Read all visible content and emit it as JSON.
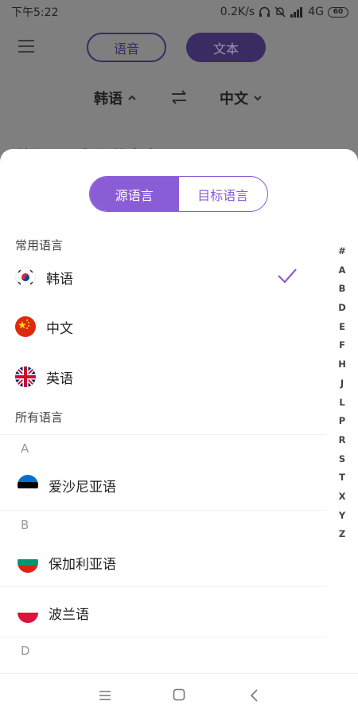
{
  "status": {
    "time": "下午5:22",
    "speed": "0.2K/s",
    "network": "4G",
    "battery": "60"
  },
  "header": {
    "tab_voice": "语音",
    "tab_text": "文本",
    "source_lang": "韩语",
    "target_lang": "中文",
    "behind_text": "输入需要翻译的文本"
  },
  "sheet": {
    "seg_source": "源语言",
    "seg_target": "目标语言",
    "common_title": "常用语言",
    "common": [
      {
        "name": "韩语",
        "flag": "korea-flag",
        "selected": true
      },
      {
        "name": "中文",
        "flag": "china-flag"
      },
      {
        "name": "英语",
        "flag": "uk-flag"
      }
    ],
    "all_title": "所有语言",
    "groups": [
      {
        "letter": "A",
        "items": [
          {
            "name": "爱沙尼亚语",
            "flag": "estonia-flag"
          }
        ]
      },
      {
        "letter": "B",
        "items": [
          {
            "name": "保加利亚语",
            "flag": "bulgaria-flag"
          },
          {
            "name": "波兰语",
            "flag": "poland-flag"
          }
        ]
      },
      {
        "letter": "D",
        "items": []
      }
    ],
    "index": [
      "#",
      "A",
      "B",
      "D",
      "E",
      "F",
      "H",
      "J",
      "L",
      "P",
      "R",
      "S",
      "T",
      "X",
      "Y",
      "Z"
    ]
  },
  "colors": {
    "accent": "#8a5cd6",
    "header_dark": "#3a2b63"
  }
}
